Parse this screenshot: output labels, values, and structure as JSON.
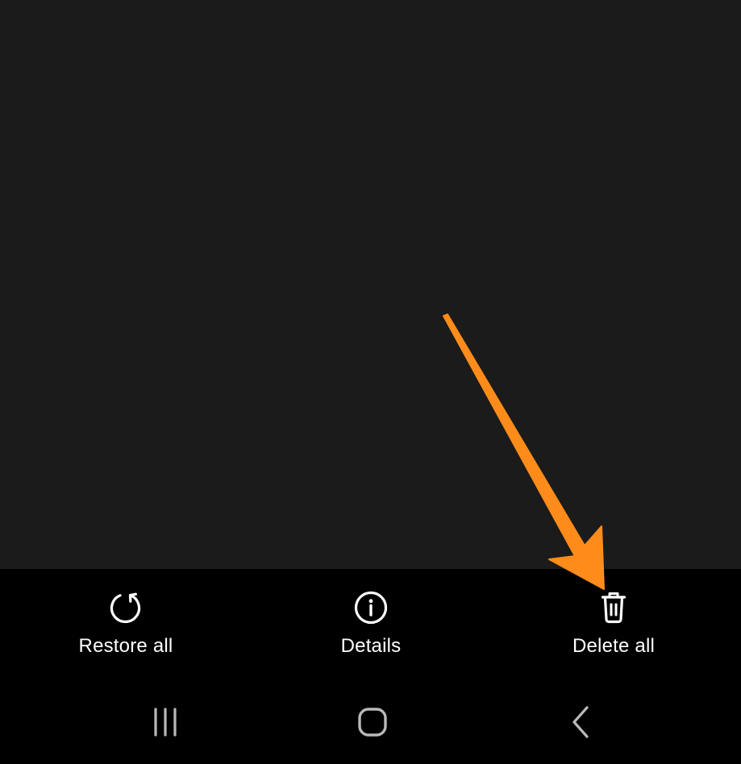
{
  "actions": {
    "restore_label": "Restore all",
    "details_label": "Details",
    "delete_label": "Delete all"
  },
  "icons": {
    "restore": "restore-icon",
    "details": "info-icon",
    "delete": "trash-icon",
    "recents": "recent-apps-icon",
    "home": "home-icon",
    "back": "back-icon"
  },
  "colors": {
    "content_background": "#1b1b1b",
    "bar_background": "#000000",
    "icon_and_text": "#ffffff",
    "nav_icons": "#b9b9b9",
    "annotation_arrow": "#ff8c1a"
  }
}
